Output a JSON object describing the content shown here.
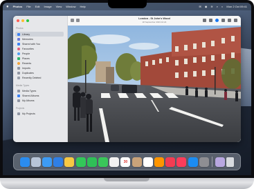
{
  "menubar": {
    "apple": "",
    "app_name": "Photos",
    "items": [
      "File",
      "Edit",
      "Image",
      "View",
      "Window",
      "Help"
    ],
    "right_items": [
      "✉",
      "◉",
      "≋",
      "⌕",
      "◐",
      "Mon 2 Oct 09:41"
    ]
  },
  "sidebar": {
    "section_photos": "Photos",
    "items": [
      {
        "label": "Library",
        "icon": "library-icon"
      },
      {
        "label": "Memories",
        "icon": "memories-icon"
      },
      {
        "label": "Shared with You",
        "icon": "shared-icon"
      },
      {
        "label": "Favourites",
        "icon": "heart-icon"
      },
      {
        "label": "People",
        "icon": "people-icon"
      },
      {
        "label": "Places",
        "icon": "places-icon"
      },
      {
        "label": "Recents",
        "icon": "clock-icon"
      },
      {
        "label": "Imports",
        "icon": "import-icon"
      },
      {
        "label": "Duplicates",
        "icon": "duplicates-icon"
      },
      {
        "label": "Recently Deleted",
        "icon": "trash-icon"
      }
    ],
    "section_media": "Media Types",
    "section_shared": "Shared Albums",
    "shared_items": [
      {
        "label": "Shared Albums",
        "icon": "shared-album-icon"
      }
    ],
    "section_albums": "My Albums",
    "section_projects": "Projects",
    "project_items": [
      {
        "label": "My Projects",
        "icon": "projects-icon"
      }
    ]
  },
  "viewer": {
    "title": "London - St John's Wood",
    "subtitle": "18 September 2023 10:24"
  },
  "dock": {
    "apps": [
      {
        "name": "Finder",
        "color": "#2a8cf0"
      },
      {
        "name": "Launchpad",
        "color": "#b7c4d8"
      },
      {
        "name": "Mail",
        "color": "#3d9bf5"
      },
      {
        "name": "Safari",
        "color": "#2f7fe6"
      },
      {
        "name": "Notes",
        "color": "#f7c843"
      },
      {
        "name": "Messages",
        "color": "#33c759"
      },
      {
        "name": "FaceTime",
        "color": "#2fbf57"
      },
      {
        "name": "Phone",
        "color": "#3ac65a"
      },
      {
        "name": "Photos",
        "color": "#f2f2f2"
      },
      {
        "name": "Calendar",
        "color": "#ffffff"
      },
      {
        "name": "Contacts",
        "color": "#c9a37a"
      },
      {
        "name": "Reminders",
        "color": "#ffffff"
      },
      {
        "name": "Books",
        "color": "#ff9500"
      },
      {
        "name": "News",
        "color": "#f23c52"
      },
      {
        "name": "Music",
        "color": "#fc3c5a"
      },
      {
        "name": "App Store",
        "color": "#1b8cf2"
      },
      {
        "name": "System Settings",
        "color": "#8e8e93"
      },
      {
        "name": "Preview",
        "color": "#b8a7e0"
      },
      {
        "name": "Trash",
        "color": "#d7dade"
      }
    ],
    "calendar_day": "30"
  }
}
